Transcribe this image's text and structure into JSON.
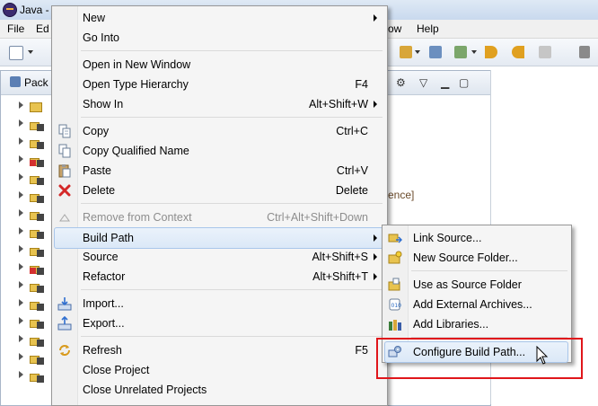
{
  "window": {
    "title": "Java - "
  },
  "menubar": {
    "file": "File",
    "edit": "Ed",
    "window": "ow",
    "help": "Help"
  },
  "explorer": {
    "tab_label": "Pack"
  },
  "background": {
    "ref_fragment": "rence]"
  },
  "context_menu": {
    "items": [
      {
        "label": "New",
        "shortcut": "",
        "submenu": true
      },
      {
        "label": "Go Into",
        "shortcut": ""
      },
      {
        "label": "Open in New Window",
        "shortcut": ""
      },
      {
        "label": "Open Type Hierarchy",
        "shortcut": "F4"
      },
      {
        "label": "Show In",
        "shortcut": "Alt+Shift+W",
        "submenu": true
      },
      {
        "label": "Copy",
        "shortcut": "Ctrl+C"
      },
      {
        "label": "Copy Qualified Name",
        "shortcut": ""
      },
      {
        "label": "Paste",
        "shortcut": "Ctrl+V"
      },
      {
        "label": "Delete",
        "shortcut": "Delete"
      },
      {
        "label": "Remove from Context",
        "shortcut": "Ctrl+Alt+Shift+Down",
        "disabled": true
      },
      {
        "label": "Build Path",
        "shortcut": "",
        "submenu": true,
        "highlighted": true
      },
      {
        "label": "Source",
        "shortcut": "Alt+Shift+S",
        "submenu": true
      },
      {
        "label": "Refactor",
        "shortcut": "Alt+Shift+T",
        "submenu": true
      },
      {
        "label": "Import...",
        "shortcut": ""
      },
      {
        "label": "Export...",
        "shortcut": ""
      },
      {
        "label": "Refresh",
        "shortcut": "F5"
      },
      {
        "label": "Close Project",
        "shortcut": ""
      },
      {
        "label": "Close Unrelated Projects",
        "shortcut": ""
      }
    ]
  },
  "build_path_menu": {
    "items": [
      {
        "label": "Link Source..."
      },
      {
        "label": "New Source Folder..."
      },
      {
        "label": "Use as Source Folder"
      },
      {
        "label": "Add External Archives..."
      },
      {
        "label": "Add Libraries..."
      },
      {
        "label": "Configure Build Path..."
      }
    ]
  },
  "colors": {
    "highlight_border": "#e0161b",
    "menu_hover": "#dbe8f7"
  }
}
